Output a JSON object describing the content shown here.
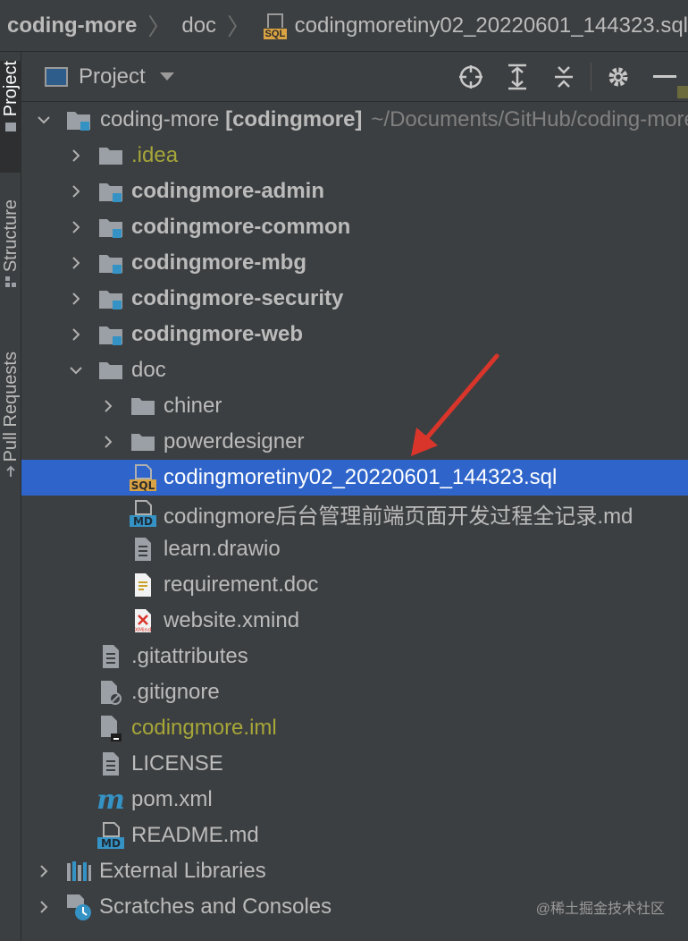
{
  "breadcrumb": {
    "root": "coding-more",
    "folder": "doc",
    "file_badge": "SQL",
    "file": "codingmoretiny02_20220601_144323.sql"
  },
  "side_tabs": {
    "project": "Project",
    "structure": "Structure",
    "pull_requests": "Pull Requests"
  },
  "panel": {
    "title": "Project"
  },
  "tree": {
    "root": {
      "label": "coding-more",
      "module": "[codingmore]",
      "path": "~/Documents/GitHub/coding-more"
    },
    "idea": ".idea",
    "admin": "codingmore-admin",
    "common": "codingmore-common",
    "mbg": "codingmore-mbg",
    "security": "codingmore-security",
    "web": "codingmore-web",
    "doc": "doc",
    "chiner": "chiner",
    "powerdesigner": "powerdesigner",
    "sql_file": "codingmoretiny02_20220601_144323.sql",
    "md_file": "codingmore后台管理前端页面开发过程全记录.md",
    "drawio": "learn.drawio",
    "requirement": "requirement.doc",
    "xmind": "website.xmind",
    "gitattributes": ".gitattributes",
    "gitignore": ".gitignore",
    "iml": "codingmore.iml",
    "license": "LICENSE",
    "pom": "pom.xml",
    "readme": "README.md",
    "external_libraries": "External Libraries",
    "scratches": "Scratches and Consoles"
  },
  "icon_labels": {
    "sql": "SQL",
    "md": "MD",
    "xmind": "XMind"
  },
  "watermark": "@稀土掘金技术社区",
  "colors": {
    "selection": "#2f65ca",
    "folder": "#9aa0a6",
    "module_dot": "#3592c4",
    "excluded": "#a6a639",
    "annotation_arrow": "#d9352b"
  }
}
